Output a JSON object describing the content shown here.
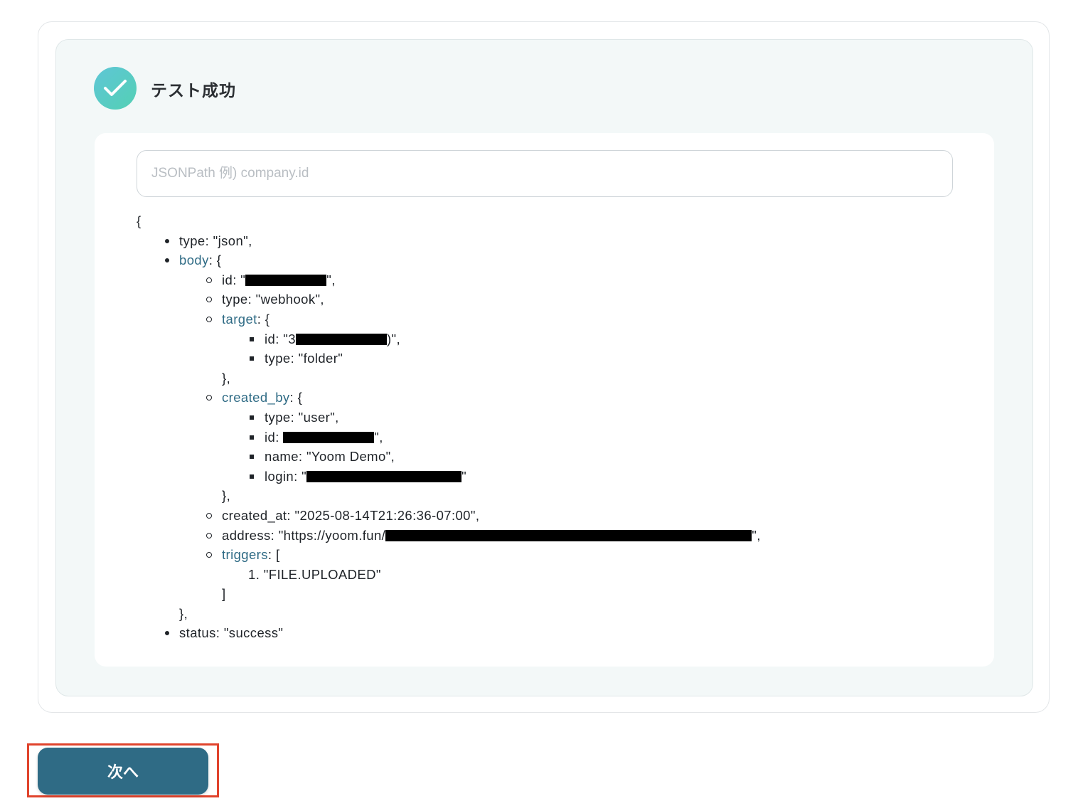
{
  "result": {
    "status_title": "テスト成功",
    "status_color": "#54d0b4"
  },
  "jsonpath": {
    "placeholder": "JSONPath 例) company.id",
    "value": ""
  },
  "json_tree": {
    "open_brace": "{",
    "type_line": "type: \"json\",",
    "body_key": "body",
    "body_open": ": {",
    "body_id_prefix": "id: \"",
    "body_id_suffix": "\",",
    "body_type": "type: \"webhook\",",
    "target_key": "target",
    "target_open": ": {",
    "target_id_prefix": "id: \"3",
    "target_id_suffix": ")\",",
    "target_type": "type: \"folder\"",
    "target_close": "},",
    "created_by_key": "created_by",
    "created_by_open": ": {",
    "created_by_type": "type: \"user\",",
    "created_by_id_prefix": "id: ",
    "created_by_id_suffix": "\",",
    "created_by_name": "name: \"Yoom Demo\",",
    "created_by_login_prefix": "login: \"",
    "created_by_login_suffix": "\"",
    "created_by_close": "},",
    "created_at": "created_at: \"2025-08-14T21:26:36-07:00\",",
    "address_prefix": "address: \"https://yoom.fun/",
    "address_suffix": "\",",
    "triggers_key": "triggers",
    "triggers_open": ": [",
    "trigger_1_num": "1.",
    "trigger_1": "\"FILE.UPLOADED\"",
    "triggers_close": "]",
    "body_close": "},",
    "status_line": "status: \"success\""
  },
  "footer": {
    "next_label": "次へ",
    "highlight_color": "#e0432c",
    "button_color": "#2f6b85"
  }
}
